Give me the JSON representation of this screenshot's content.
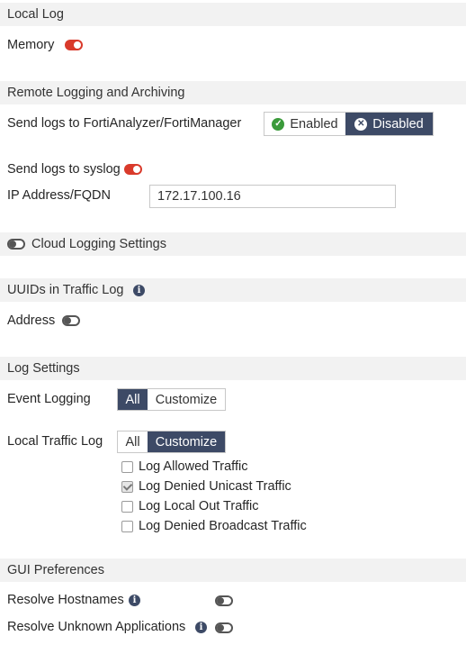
{
  "sections": {
    "local_log": "Local Log",
    "remote_logging": "Remote Logging and Archiving",
    "uuids": "UUIDs in Traffic Log",
    "log_settings": "Log Settings",
    "gui_preferences": "GUI Preferences"
  },
  "local_log": {
    "memory_label": "Memory",
    "memory_enabled": true
  },
  "remote": {
    "forti_label": "Send logs to FortiAnalyzer/FortiManager",
    "forti_options": [
      "Enabled",
      "Disabled"
    ],
    "forti_selected": "Disabled",
    "syslog_label": "Send logs to syslog",
    "syslog_enabled": true,
    "ip_label": "IP Address/FQDN",
    "ip_value": "172.17.100.16",
    "cloud_label": "Cloud Logging Settings",
    "cloud_enabled": false
  },
  "uuids": {
    "address_label": "Address",
    "address_enabled": false
  },
  "log_settings": {
    "event_label": "Event Logging",
    "event_options": [
      "All",
      "Customize"
    ],
    "event_selected": "All",
    "traffic_label": "Local Traffic Log",
    "traffic_options": [
      "All",
      "Customize"
    ],
    "traffic_selected": "Customize",
    "checkboxes": [
      {
        "label": "Log Allowed Traffic",
        "checked": false
      },
      {
        "label": "Log Denied Unicast Traffic",
        "checked": true
      },
      {
        "label": "Log Local Out Traffic",
        "checked": false
      },
      {
        "label": "Log Denied Broadcast Traffic",
        "checked": false
      }
    ]
  },
  "gui": {
    "resolve_hostnames_label": "Resolve Hostnames",
    "resolve_hostnames_enabled": false,
    "resolve_apps_label": "Resolve Unknown Applications",
    "resolve_apps_enabled": false
  },
  "icons": {
    "info": "info-icon",
    "enabled": "check-circle-icon",
    "disabled": "x-circle-icon"
  },
  "colors": {
    "toggle_on": "#d93a2b",
    "active_segment": "#3d4a66",
    "section_bar": "#f2f2f2",
    "enabled_check": "#3a9a3a"
  }
}
